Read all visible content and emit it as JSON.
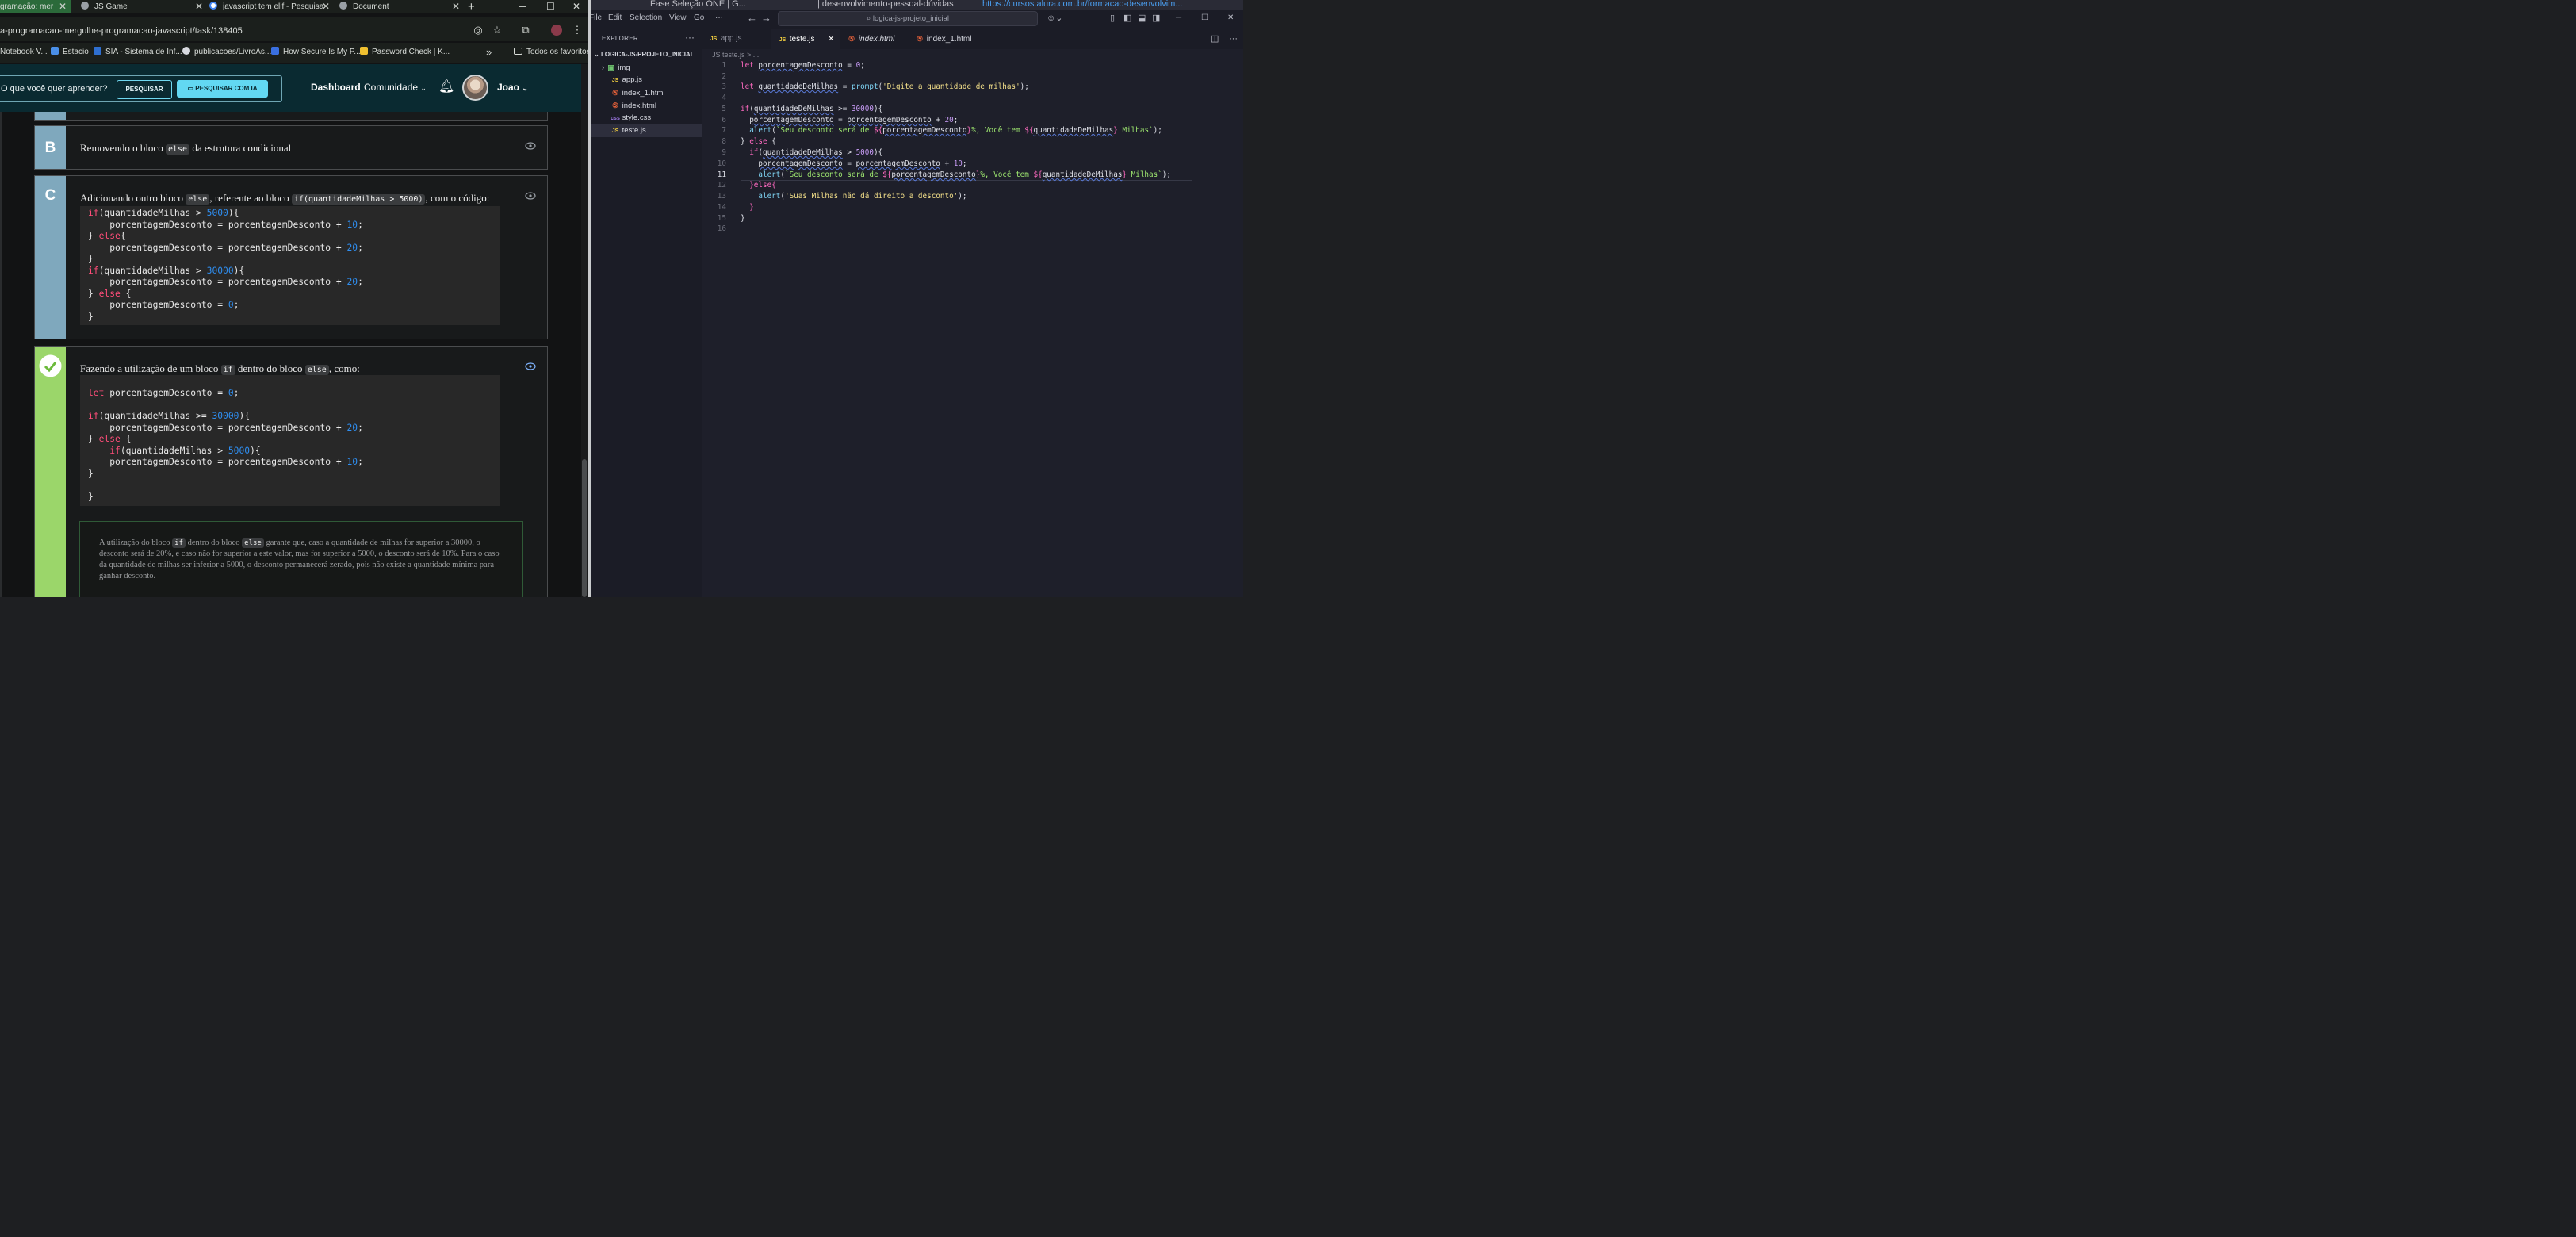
{
  "browser": {
    "tabs": [
      {
        "title": "gramação: mer",
        "color": "#2b6a3a",
        "favicon": "#e8b44a"
      },
      {
        "title": "JS Game",
        "favicon": "#9aa0a6"
      },
      {
        "title": "javascript tem elif - Pesquisa",
        "favicon": "#4285f4"
      },
      {
        "title": "Document",
        "favicon": "#9aa0a6"
      }
    ],
    "new_tab": "+",
    "window_controls": {
      "minimize": "─",
      "maximize": "☐",
      "close": "✕"
    },
    "url": "a-programacao-mergulhe-programacao-javascript/task/138405",
    "bookmarks": [
      {
        "label": "Notebook V...",
        "color": "#f3c43a"
      },
      {
        "label": "Estacio",
        "color": "#4a8fe8"
      },
      {
        "label": "SIA - Sistema de Inf...",
        "color": "#2f6fd0"
      },
      {
        "label": "publicacoes/LivroAs...",
        "color": "#d8dae0"
      },
      {
        "label": "How Secure Is My P...",
        "color": "#3a6fe0"
      },
      {
        "label": "Password Check | K...",
        "color": "#f0c030"
      }
    ],
    "bookmarks_more": "»",
    "bookmarks_folder": "Todos os favoritos"
  },
  "site": {
    "search_placeholder": "O que você quer aprender?",
    "search_button": "PESQUISAR",
    "search_ia_button": "PESQUISAR COM IA",
    "nav_dashboard": "Dashboard",
    "nav_comunidade": "Comunidade",
    "user_name": "Joao"
  },
  "options": {
    "b": {
      "letter": "B",
      "text_before": "Removendo o bloco ",
      "code": "else",
      "text_after": " da estrutura condicional"
    },
    "c": {
      "letter": "C",
      "text_before": "Adicionando outro bloco ",
      "code1": "else",
      "text_mid": ", referente ao bloco ",
      "code2": "if(quantidadeMilhas > 5000)",
      "text_after": ", com o código:"
    },
    "d": {
      "text_before": "Fazendo a utilização de um bloco ",
      "code1": "if",
      "text_mid": " dentro do bloco ",
      "code2": "else",
      "text_after": ", como:"
    },
    "explanation": {
      "t1": "A utilização do bloco ",
      "c1": "if",
      "t2": " dentro do bloco ",
      "c2": "else",
      "t3": " garante que, caso a quantidade de milhas for superior a 30000, o desconto será de 20%, e caso não for superior a este valor, mas for superior a 5000, o desconto será de 10%. Para o caso da quantidade de milhas ser inferior a 5000, o desconto permanecerá zerado, pois não existe a quantidade mínima para ganhar desconto."
    }
  },
  "vscode": {
    "top_strip": {
      "item1": "Fase Seleção ONE | G...",
      "item2": "| desenvolvimento-pessoal-dúvidas",
      "item3": "https://cursos.alura.com.br/formacao-desenvolvim..."
    },
    "menu": [
      "File",
      "Edit",
      "Selection",
      "View",
      "Go",
      "···"
    ],
    "search": "logica-js-projeto_inicial",
    "explorer_title": "EXPLORER",
    "project": "LOGICA-JS-PROJETO_INICIAL",
    "files": [
      {
        "name": "img",
        "kind": "folder"
      },
      {
        "name": "app.js",
        "kind": "js"
      },
      {
        "name": "index_1.html",
        "kind": "html"
      },
      {
        "name": "index.html",
        "kind": "html"
      },
      {
        "name": "style.css",
        "kind": "css"
      },
      {
        "name": "teste.js",
        "kind": "js",
        "selected": true
      }
    ],
    "tabs": [
      {
        "name": "app.js",
        "kind": "js"
      },
      {
        "name": "teste.js",
        "kind": "js",
        "active": true
      },
      {
        "name": "index.html",
        "kind": "html"
      },
      {
        "name": "index_1.html",
        "kind": "html"
      }
    ],
    "breadcrumb": "JS teste.js > ...",
    "current_line": 11,
    "line_numbers": [
      "1",
      "2",
      "3",
      "4",
      "5",
      "6",
      "7",
      "8",
      "9",
      "10",
      "11",
      "12",
      "13",
      "14",
      "15",
      "16"
    ]
  }
}
